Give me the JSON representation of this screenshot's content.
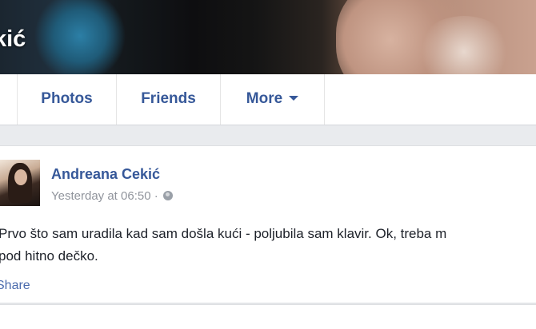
{
  "cover": {
    "name": "kić"
  },
  "tabs": [
    {
      "label": ""
    },
    {
      "label": "Photos"
    },
    {
      "label": "Friends"
    },
    {
      "label": "More"
    }
  ],
  "post": {
    "author": "Andreana Cekić",
    "timestamp": "Yesterday at 06:50",
    "separator": "·",
    "privacy_icon": "globe-icon",
    "text_line1": "Prvo što sam uradila kad sam došla kući - poljubila sam klavir. Ok, treba m",
    "text_line2": "pod hitno dečko.",
    "share_label": "Share"
  },
  "colors": {
    "link": "#365899",
    "meta": "#90949c",
    "background": "#e9ebee"
  }
}
